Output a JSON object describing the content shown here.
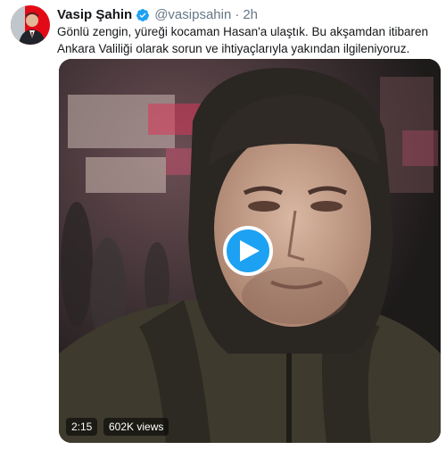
{
  "tweet": {
    "author": {
      "name": "Vasip Şahin",
      "handle": "@vasipsahin",
      "separator": "·",
      "time": "2h"
    },
    "text": "Gönlü zengin, yüreği kocaman Hasan'a ulaştık. Bu akşamdan itibaren Ankara Valiliği olarak sorun ve ihtiyaçlarıyla yakından ilgileniyoruz.",
    "media": {
      "type": "video",
      "duration": "2:15",
      "views": "602K views"
    }
  },
  "colors": {
    "accent": "#1da1f2",
    "text": "#14171a",
    "secondary": "#657786",
    "flag_red": "#e30a17"
  },
  "icons": {
    "verified": "verified-badge-icon",
    "play": "play-icon"
  }
}
